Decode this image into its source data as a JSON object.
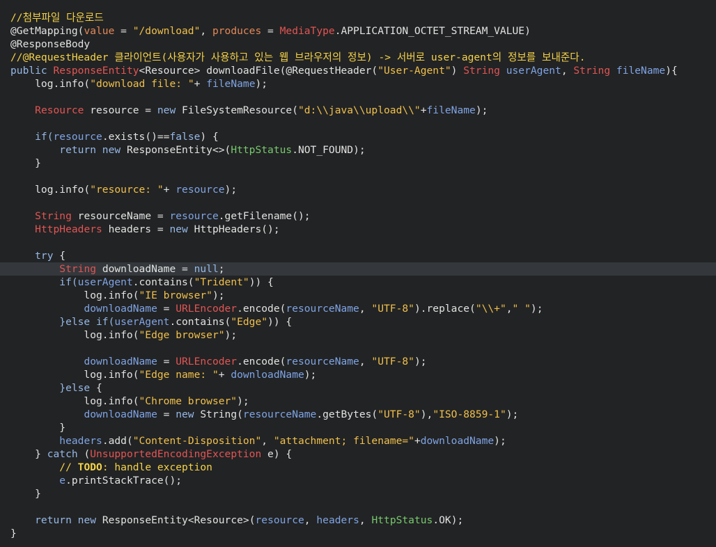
{
  "editor": {
    "lines": [
      [
        {
          "t": "//첨부파일 다운로드",
          "c": "comment"
        }
      ],
      [
        {
          "t": "@GetMapping(",
          "c": "plain"
        },
        {
          "t": "value",
          "c": "orange"
        },
        {
          "t": " = ",
          "c": "plain"
        },
        {
          "t": "\"/download\"",
          "c": "string"
        },
        {
          "t": ", ",
          "c": "plain"
        },
        {
          "t": "produces",
          "c": "orange"
        },
        {
          "t": " = ",
          "c": "plain"
        },
        {
          "t": "MediaType",
          "c": "type"
        },
        {
          "t": ".APPLICATION_OCTET_STREAM_VALUE)",
          "c": "plain"
        }
      ],
      [
        {
          "t": "@ResponseBody",
          "c": "plain"
        }
      ],
      [
        {
          "t": "//@RequestHeader 클라이언트(사용자가 사용하고 있는 웹 브라우저의 정보) -> 서버로 user-agent의 정보를 보내준다.",
          "c": "comment"
        }
      ],
      [
        {
          "t": "public ",
          "c": "keyword"
        },
        {
          "t": "ResponseEntity",
          "c": "type"
        },
        {
          "t": "<Resource> ",
          "c": "plain"
        },
        {
          "t": "downloadFile(@RequestHeader(",
          "c": "plain"
        },
        {
          "t": "\"User-Agent\"",
          "c": "string"
        },
        {
          "t": ") ",
          "c": "plain"
        },
        {
          "t": "String ",
          "c": "type"
        },
        {
          "t": "userAgent",
          "c": "param"
        },
        {
          "t": ", ",
          "c": "plain"
        },
        {
          "t": "String ",
          "c": "type"
        },
        {
          "t": "fileName",
          "c": "param"
        },
        {
          "t": "){",
          "c": "plain"
        }
      ],
      [
        {
          "t": "    log.info(",
          "c": "plain"
        },
        {
          "t": "\"download file: \"",
          "c": "string"
        },
        {
          "t": "+ ",
          "c": "plain"
        },
        {
          "t": "fileName",
          "c": "param"
        },
        {
          "t": ");",
          "c": "plain"
        }
      ],
      [],
      [
        {
          "t": "    ",
          "c": "plain"
        },
        {
          "t": "Resource ",
          "c": "type"
        },
        {
          "t": "resource = ",
          "c": "plain"
        },
        {
          "t": "new ",
          "c": "keyword"
        },
        {
          "t": "FileSystemResource(",
          "c": "plain"
        },
        {
          "t": "\"d:\\\\java\\\\upload\\\\\"",
          "c": "string"
        },
        {
          "t": "+",
          "c": "plain"
        },
        {
          "t": "fileName",
          "c": "param"
        },
        {
          "t": ");",
          "c": "plain"
        }
      ],
      [],
      [
        {
          "t": "    if(",
          "c": "keyword"
        },
        {
          "t": "resource",
          "c": "var"
        },
        {
          "t": ".exists()==",
          "c": "plain"
        },
        {
          "t": "false",
          "c": "keyword"
        },
        {
          "t": ") {",
          "c": "plain"
        }
      ],
      [
        {
          "t": "        return ",
          "c": "keyword"
        },
        {
          "t": "new ",
          "c": "keyword"
        },
        {
          "t": "ResponseEntity<>(",
          "c": "plain"
        },
        {
          "t": "HttpStatus",
          "c": "static"
        },
        {
          "t": ".NOT_FOUND);",
          "c": "plain"
        }
      ],
      [
        {
          "t": "    }",
          "c": "plain"
        }
      ],
      [],
      [
        {
          "t": "    log.info(",
          "c": "plain"
        },
        {
          "t": "\"resource: \"",
          "c": "string"
        },
        {
          "t": "+ ",
          "c": "plain"
        },
        {
          "t": "resource",
          "c": "var"
        },
        {
          "t": ");",
          "c": "plain"
        }
      ],
      [],
      [
        {
          "t": "    ",
          "c": "plain"
        },
        {
          "t": "String ",
          "c": "type"
        },
        {
          "t": "resourceName = ",
          "c": "plain"
        },
        {
          "t": "resource",
          "c": "var"
        },
        {
          "t": ".getFilename();",
          "c": "plain"
        }
      ],
      [
        {
          "t": "    ",
          "c": "plain"
        },
        {
          "t": "HttpHeaders ",
          "c": "type"
        },
        {
          "t": "headers = ",
          "c": "plain"
        },
        {
          "t": "new ",
          "c": "keyword"
        },
        {
          "t": "HttpHeaders();",
          "c": "plain"
        }
      ],
      [],
      [
        {
          "t": "    try ",
          "c": "keyword"
        },
        {
          "t": "{",
          "c": "plain"
        }
      ],
      [
        {
          "t": "        ",
          "c": "plain"
        },
        {
          "t": "String ",
          "c": "type"
        },
        {
          "t": "downloadName = ",
          "c": "plain"
        },
        {
          "t": "null",
          "c": "keyword"
        },
        {
          "t": ";",
          "c": "plain"
        }
      ],
      [
        {
          "t": "        if(",
          "c": "keyword"
        },
        {
          "t": "userAgent",
          "c": "param"
        },
        {
          "t": ".contains(",
          "c": "plain"
        },
        {
          "t": "\"Trident\"",
          "c": "string"
        },
        {
          "t": ")) {",
          "c": "plain"
        }
      ],
      [
        {
          "t": "            log.info(",
          "c": "plain"
        },
        {
          "t": "\"IE browser\"",
          "c": "string"
        },
        {
          "t": ");",
          "c": "plain"
        }
      ],
      [
        {
          "t": "            ",
          "c": "plain"
        },
        {
          "t": "downloadName",
          "c": "var"
        },
        {
          "t": " = ",
          "c": "plain"
        },
        {
          "t": "URLEncoder",
          "c": "type"
        },
        {
          "t": ".encode(",
          "c": "plain"
        },
        {
          "t": "resourceName",
          "c": "var"
        },
        {
          "t": ", ",
          "c": "plain"
        },
        {
          "t": "\"UTF-8\"",
          "c": "string"
        },
        {
          "t": ").replace(",
          "c": "plain"
        },
        {
          "t": "\"\\\\+\"",
          "c": "string"
        },
        {
          "t": ",",
          "c": "plain"
        },
        {
          "t": "\" \"",
          "c": "string"
        },
        {
          "t": ");",
          "c": "plain"
        }
      ],
      [
        {
          "t": "        }else ",
          "c": "keyword"
        },
        {
          "t": "if(",
          "c": "keyword"
        },
        {
          "t": "userAgent",
          "c": "param"
        },
        {
          "t": ".contains(",
          "c": "plain"
        },
        {
          "t": "\"Edge\"",
          "c": "string"
        },
        {
          "t": ")) {",
          "c": "plain"
        }
      ],
      [
        {
          "t": "            log.info(",
          "c": "plain"
        },
        {
          "t": "\"Edge browser\"",
          "c": "string"
        },
        {
          "t": ");",
          "c": "plain"
        }
      ],
      [],
      [
        {
          "t": "            ",
          "c": "plain"
        },
        {
          "t": "downloadName",
          "c": "var"
        },
        {
          "t": " = ",
          "c": "plain"
        },
        {
          "t": "URLEncoder",
          "c": "type"
        },
        {
          "t": ".encode(",
          "c": "plain"
        },
        {
          "t": "resourceName",
          "c": "var"
        },
        {
          "t": ", ",
          "c": "plain"
        },
        {
          "t": "\"UTF-8\"",
          "c": "string"
        },
        {
          "t": ");",
          "c": "plain"
        }
      ],
      [
        {
          "t": "            log.info(",
          "c": "plain"
        },
        {
          "t": "\"Edge name: \"",
          "c": "string"
        },
        {
          "t": "+ ",
          "c": "plain"
        },
        {
          "t": "downloadName",
          "c": "var"
        },
        {
          "t": ");",
          "c": "plain"
        }
      ],
      [
        {
          "t": "        }else ",
          "c": "keyword"
        },
        {
          "t": "{",
          "c": "plain"
        }
      ],
      [
        {
          "t": "            log.info(",
          "c": "plain"
        },
        {
          "t": "\"Chrome browser\"",
          "c": "string"
        },
        {
          "t": ");",
          "c": "plain"
        }
      ],
      [
        {
          "t": "            ",
          "c": "plain"
        },
        {
          "t": "downloadName",
          "c": "var"
        },
        {
          "t": " = ",
          "c": "plain"
        },
        {
          "t": "new ",
          "c": "keyword"
        },
        {
          "t": "String(",
          "c": "plain"
        },
        {
          "t": "resourceName",
          "c": "var"
        },
        {
          "t": ".getBytes(",
          "c": "plain"
        },
        {
          "t": "\"UTF-8\"",
          "c": "string"
        },
        {
          "t": "),",
          "c": "plain"
        },
        {
          "t": "\"ISO-8859-1\"",
          "c": "string"
        },
        {
          "t": ");",
          "c": "plain"
        }
      ],
      [
        {
          "t": "        }",
          "c": "plain"
        }
      ],
      [
        {
          "t": "        ",
          "c": "plain"
        },
        {
          "t": "headers",
          "c": "var"
        },
        {
          "t": ".add(",
          "c": "plain"
        },
        {
          "t": "\"Content-Disposition\"",
          "c": "string"
        },
        {
          "t": ", ",
          "c": "plain"
        },
        {
          "t": "\"attachment; filename=\"",
          "c": "string"
        },
        {
          "t": "+",
          "c": "plain"
        },
        {
          "t": "downloadName",
          "c": "var"
        },
        {
          "t": ");",
          "c": "plain"
        }
      ],
      [
        {
          "t": "    } ",
          "c": "plain"
        },
        {
          "t": "catch ",
          "c": "keyword"
        },
        {
          "t": "(",
          "c": "plain"
        },
        {
          "t": "UnsupportedEncodingException ",
          "c": "type"
        },
        {
          "t": "e) {",
          "c": "plain"
        }
      ],
      [
        {
          "t": "        // ",
          "c": "comment"
        },
        {
          "t": "TODO",
          "c": "todo"
        },
        {
          "t": ": handle exception",
          "c": "comment"
        }
      ],
      [
        {
          "t": "        ",
          "c": "plain"
        },
        {
          "t": "e",
          "c": "var"
        },
        {
          "t": ".printStackTrace();",
          "c": "plain"
        }
      ],
      [
        {
          "t": "    }",
          "c": "plain"
        }
      ],
      [],
      [
        {
          "t": "    return ",
          "c": "keyword"
        },
        {
          "t": "new ",
          "c": "keyword"
        },
        {
          "t": "ResponseEntity",
          "c": "plain"
        },
        {
          "t": "<Resource>",
          "c": "plain"
        },
        {
          "t": "(",
          "c": "plain"
        },
        {
          "t": "resource",
          "c": "var"
        },
        {
          "t": ", ",
          "c": "plain"
        },
        {
          "t": "headers",
          "c": "var"
        },
        {
          "t": ", ",
          "c": "plain"
        },
        {
          "t": "HttpStatus",
          "c": "static"
        },
        {
          "t": ".OK);",
          "c": "plain"
        }
      ],
      [
        {
          "t": "}",
          "c": "plain"
        }
      ]
    ],
    "current_line_index": 19,
    "colors": {
      "background": "#222324",
      "current_line": "#34383c",
      "comment": "#f5d34a",
      "keyword": "#95b8e8",
      "type": "#e25555",
      "string": "#f0c04c",
      "variable": "#7fa4e5",
      "static": "#77c96e",
      "plain": "#e2e2e2"
    }
  }
}
